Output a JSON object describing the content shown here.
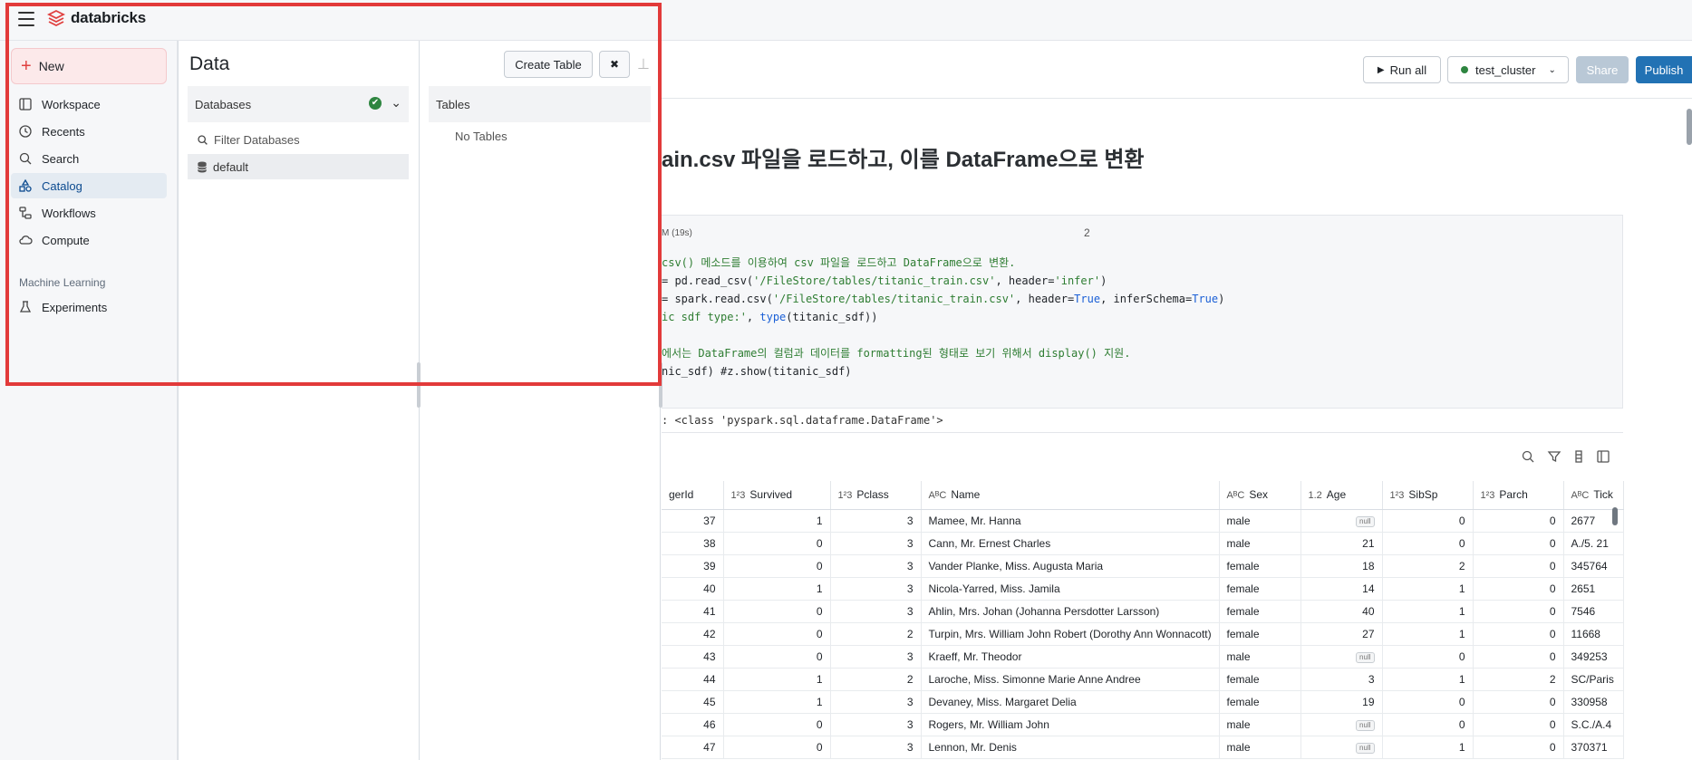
{
  "app": {
    "logo_text": "databricks"
  },
  "leftnav": {
    "new_label": "New",
    "items": [
      {
        "label": "Workspace",
        "icon": "workspace-icon"
      },
      {
        "label": "Recents",
        "icon": "clock-icon"
      },
      {
        "label": "Search",
        "icon": "search-icon"
      },
      {
        "label": "Catalog",
        "icon": "catalog-icon",
        "active": true
      },
      {
        "label": "Workflows",
        "icon": "workflows-icon"
      },
      {
        "label": "Compute",
        "icon": "cloud-icon"
      }
    ],
    "section_ml": "Machine Learning",
    "ml_items": [
      {
        "label": "Experiments",
        "icon": "flask-icon"
      }
    ]
  },
  "data_panel": {
    "title": "Data",
    "create_table_label": "Create Table",
    "close_label": "✖",
    "databases_header": "Databases",
    "filter_placeholder": "Filter Databases",
    "databases": [
      "default"
    ],
    "tables_header": "Tables",
    "no_tables": "No Tables"
  },
  "notebook": {
    "run_all_label": "Run all",
    "cluster_label": "test_cluster",
    "share_label": "Share",
    "publish_label": "Publish",
    "heading": "ain.csv 파일을 로드하고, 이를 DataFrame으로 변환",
    "cell_meta": "M (19s)",
    "cell_number": "2",
    "output_text": ": <class 'pyspark.sql.dataframe.DataFrame'>",
    "code": {
      "l1": "csv() 메소드를 이용하여 csv 파일을 로드하고 DataFrame으로 변환.",
      "l2a": "= pd.read_csv(",
      "l2b": "'/FileStore/tables/titanic_train.csv'",
      "l2c": ", header=",
      "l2d": "'infer'",
      "l2e": ")",
      "l3a": "= spark.read.csv(",
      "l3b": "'/FileStore/tables/titanic_train.csv'",
      "l3c": ", header=",
      "l3d": "True",
      "l3e": ", inferSchema=",
      "l3f": "True",
      "l3g": ")",
      "l4a": "ic sdf type:'",
      "l4b": ", ",
      "l4c": "type",
      "l4d": "(titanic_sdf))",
      "l6": "에서는 DataFrame의 컬럼과 데이터를 formatting된 형태로 보기 위해서 display() 지원.",
      "l7": "nic_sdf) #z.show(titanic_sdf)"
    }
  },
  "table": {
    "columns": [
      {
        "type": "",
        "name": "gerId"
      },
      {
        "type": "1²3",
        "name": "Survived"
      },
      {
        "type": "1²3",
        "name": "Pclass"
      },
      {
        "type": "AᴮC",
        "name": "Name"
      },
      {
        "type": "AᴮC",
        "name": "Sex"
      },
      {
        "type": "1.2",
        "name": "Age"
      },
      {
        "type": "1²3",
        "name": "SibSp"
      },
      {
        "type": "1²3",
        "name": "Parch"
      },
      {
        "type": "AᴮC",
        "name": "Tick"
      }
    ],
    "null_label": "null",
    "rows": [
      [
        "37",
        "1",
        "3",
        "Mamee, Mr. Hanna",
        "male",
        "null",
        "0",
        "0",
        "2677"
      ],
      [
        "38",
        "0",
        "3",
        "Cann, Mr. Ernest Charles",
        "male",
        "21",
        "0",
        "0",
        "A./5. 21"
      ],
      [
        "39",
        "0",
        "3",
        "Vander Planke, Miss. Augusta Maria",
        "female",
        "18",
        "2",
        "0",
        "345764"
      ],
      [
        "40",
        "1",
        "3",
        "Nicola-Yarred, Miss. Jamila",
        "female",
        "14",
        "1",
        "0",
        "2651"
      ],
      [
        "41",
        "0",
        "3",
        "Ahlin, Mrs. Johan (Johanna Persdotter Larsson)",
        "female",
        "40",
        "1",
        "0",
        "7546"
      ],
      [
        "42",
        "0",
        "2",
        "Turpin, Mrs. William John Robert (Dorothy Ann Wonnacott)",
        "female",
        "27",
        "1",
        "0",
        "11668"
      ],
      [
        "43",
        "0",
        "3",
        "Kraeff, Mr. Theodor",
        "male",
        "null",
        "0",
        "0",
        "349253"
      ],
      [
        "44",
        "1",
        "2",
        "Laroche, Miss. Simonne Marie Anne Andree",
        "female",
        "3",
        "1",
        "2",
        "SC/Paris"
      ],
      [
        "45",
        "1",
        "3",
        "Devaney, Miss. Margaret Delia",
        "female",
        "19",
        "0",
        "0",
        "330958"
      ],
      [
        "46",
        "0",
        "3",
        "Rogers, Mr. William John",
        "male",
        "null",
        "0",
        "0",
        "S.C./A.4"
      ],
      [
        "47",
        "0",
        "3",
        "Lennon, Mr. Denis",
        "male",
        "null",
        "1",
        "0",
        "370371"
      ]
    ]
  }
}
